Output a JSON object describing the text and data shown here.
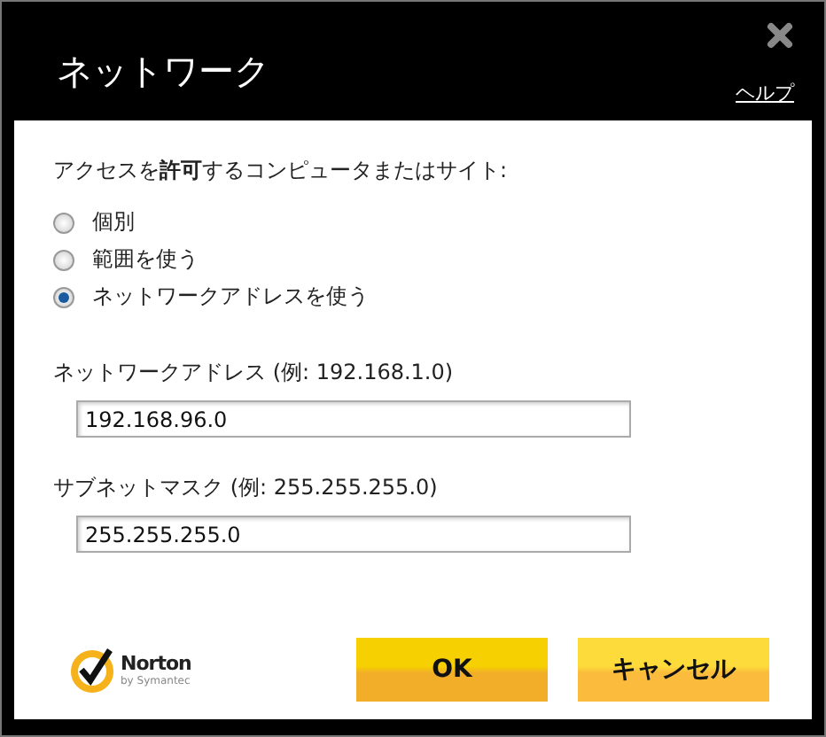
{
  "window": {
    "title": "ネットワーク",
    "help_link": "ヘルプ"
  },
  "prompt": "アクセスを**許可**するコンピュータまたはサイト:",
  "options": [
    {
      "label": "個別",
      "selected": false
    },
    {
      "label": "範囲を使う",
      "selected": false
    },
    {
      "label": "ネットワークアドレスを使う",
      "selected": true
    }
  ],
  "fields": [
    {
      "label": "ネットワークアドレス (例: 192.168.1.0)",
      "value": "192.168.96.0"
    },
    {
      "label": "サブネットマスク (例: 255.255.255.0)",
      "value": "255.255.255.0"
    }
  ],
  "logo": {
    "name": "Norton",
    "tagline": "by Symantec"
  },
  "buttons": [
    {
      "label": "OK",
      "kind": "primary"
    },
    {
      "label": "キャンセル",
      "kind": "secondary"
    }
  ]
}
